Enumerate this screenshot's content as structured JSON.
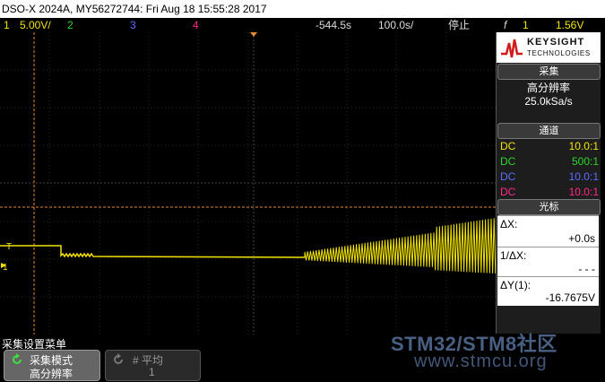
{
  "title_bar": {
    "text": "DSO-X 2024A, MY56272744: Fri Aug 18 15:55:28 2017"
  },
  "top_bar": {
    "ch1_number": "1",
    "ch1_scale": "5.00V/",
    "ch2_number": "2",
    "ch3_number": "3",
    "ch4_number": "4",
    "time_offset": "-544.5s",
    "timebase": "100.0s/",
    "run_state": "停止",
    "trigger_icon": "f",
    "trigger_channel": "1",
    "trigger_level": "1.56V",
    "ch1_color": "#f2e400",
    "ch2_color": "#2bd82b",
    "ch3_color": "#5a6cff",
    "ch4_color": "#ff2a8a"
  },
  "right_panel": {
    "logo_brand": "KEYSIGHT",
    "logo_sub": "TECHNOLOGIES",
    "acquisition": {
      "header": "采集",
      "mode": "高分辨率",
      "rate": "25.0kSa/s"
    },
    "channels": {
      "header": "通道",
      "rows": [
        {
          "coupling": "DC",
          "probe": "10.0:1",
          "color": "#f2e400"
        },
        {
          "coupling": "DC",
          "probe": "500:1",
          "color": "#2bd82b"
        },
        {
          "coupling": "DC",
          "probe": "10.0:1",
          "color": "#5a6cff"
        },
        {
          "coupling": "DC",
          "probe": "10.0:1",
          "color": "#ff2a8a"
        }
      ]
    },
    "cursors": {
      "header": "光标",
      "dx_label": "ΔX:",
      "dx_value": "+0.0s",
      "inv_dx_label": "1/ΔX:",
      "inv_dx_value": "- - -",
      "dy_label": "ΔY(1):",
      "dy_value": "-16.7675V"
    }
  },
  "screen": {
    "ch1_marker": "1",
    "trigger_marker": "T"
  },
  "bottom_menu": {
    "title": "采集设置菜单",
    "softkey1_line1": "采集模式",
    "softkey1_line2": "高分辨率",
    "softkey2_line1": "# 平均",
    "softkey2_line2": "1"
  },
  "watermark": {
    "line1": "STM32/STM8社区",
    "line2": "www.stmcu.org"
  }
}
